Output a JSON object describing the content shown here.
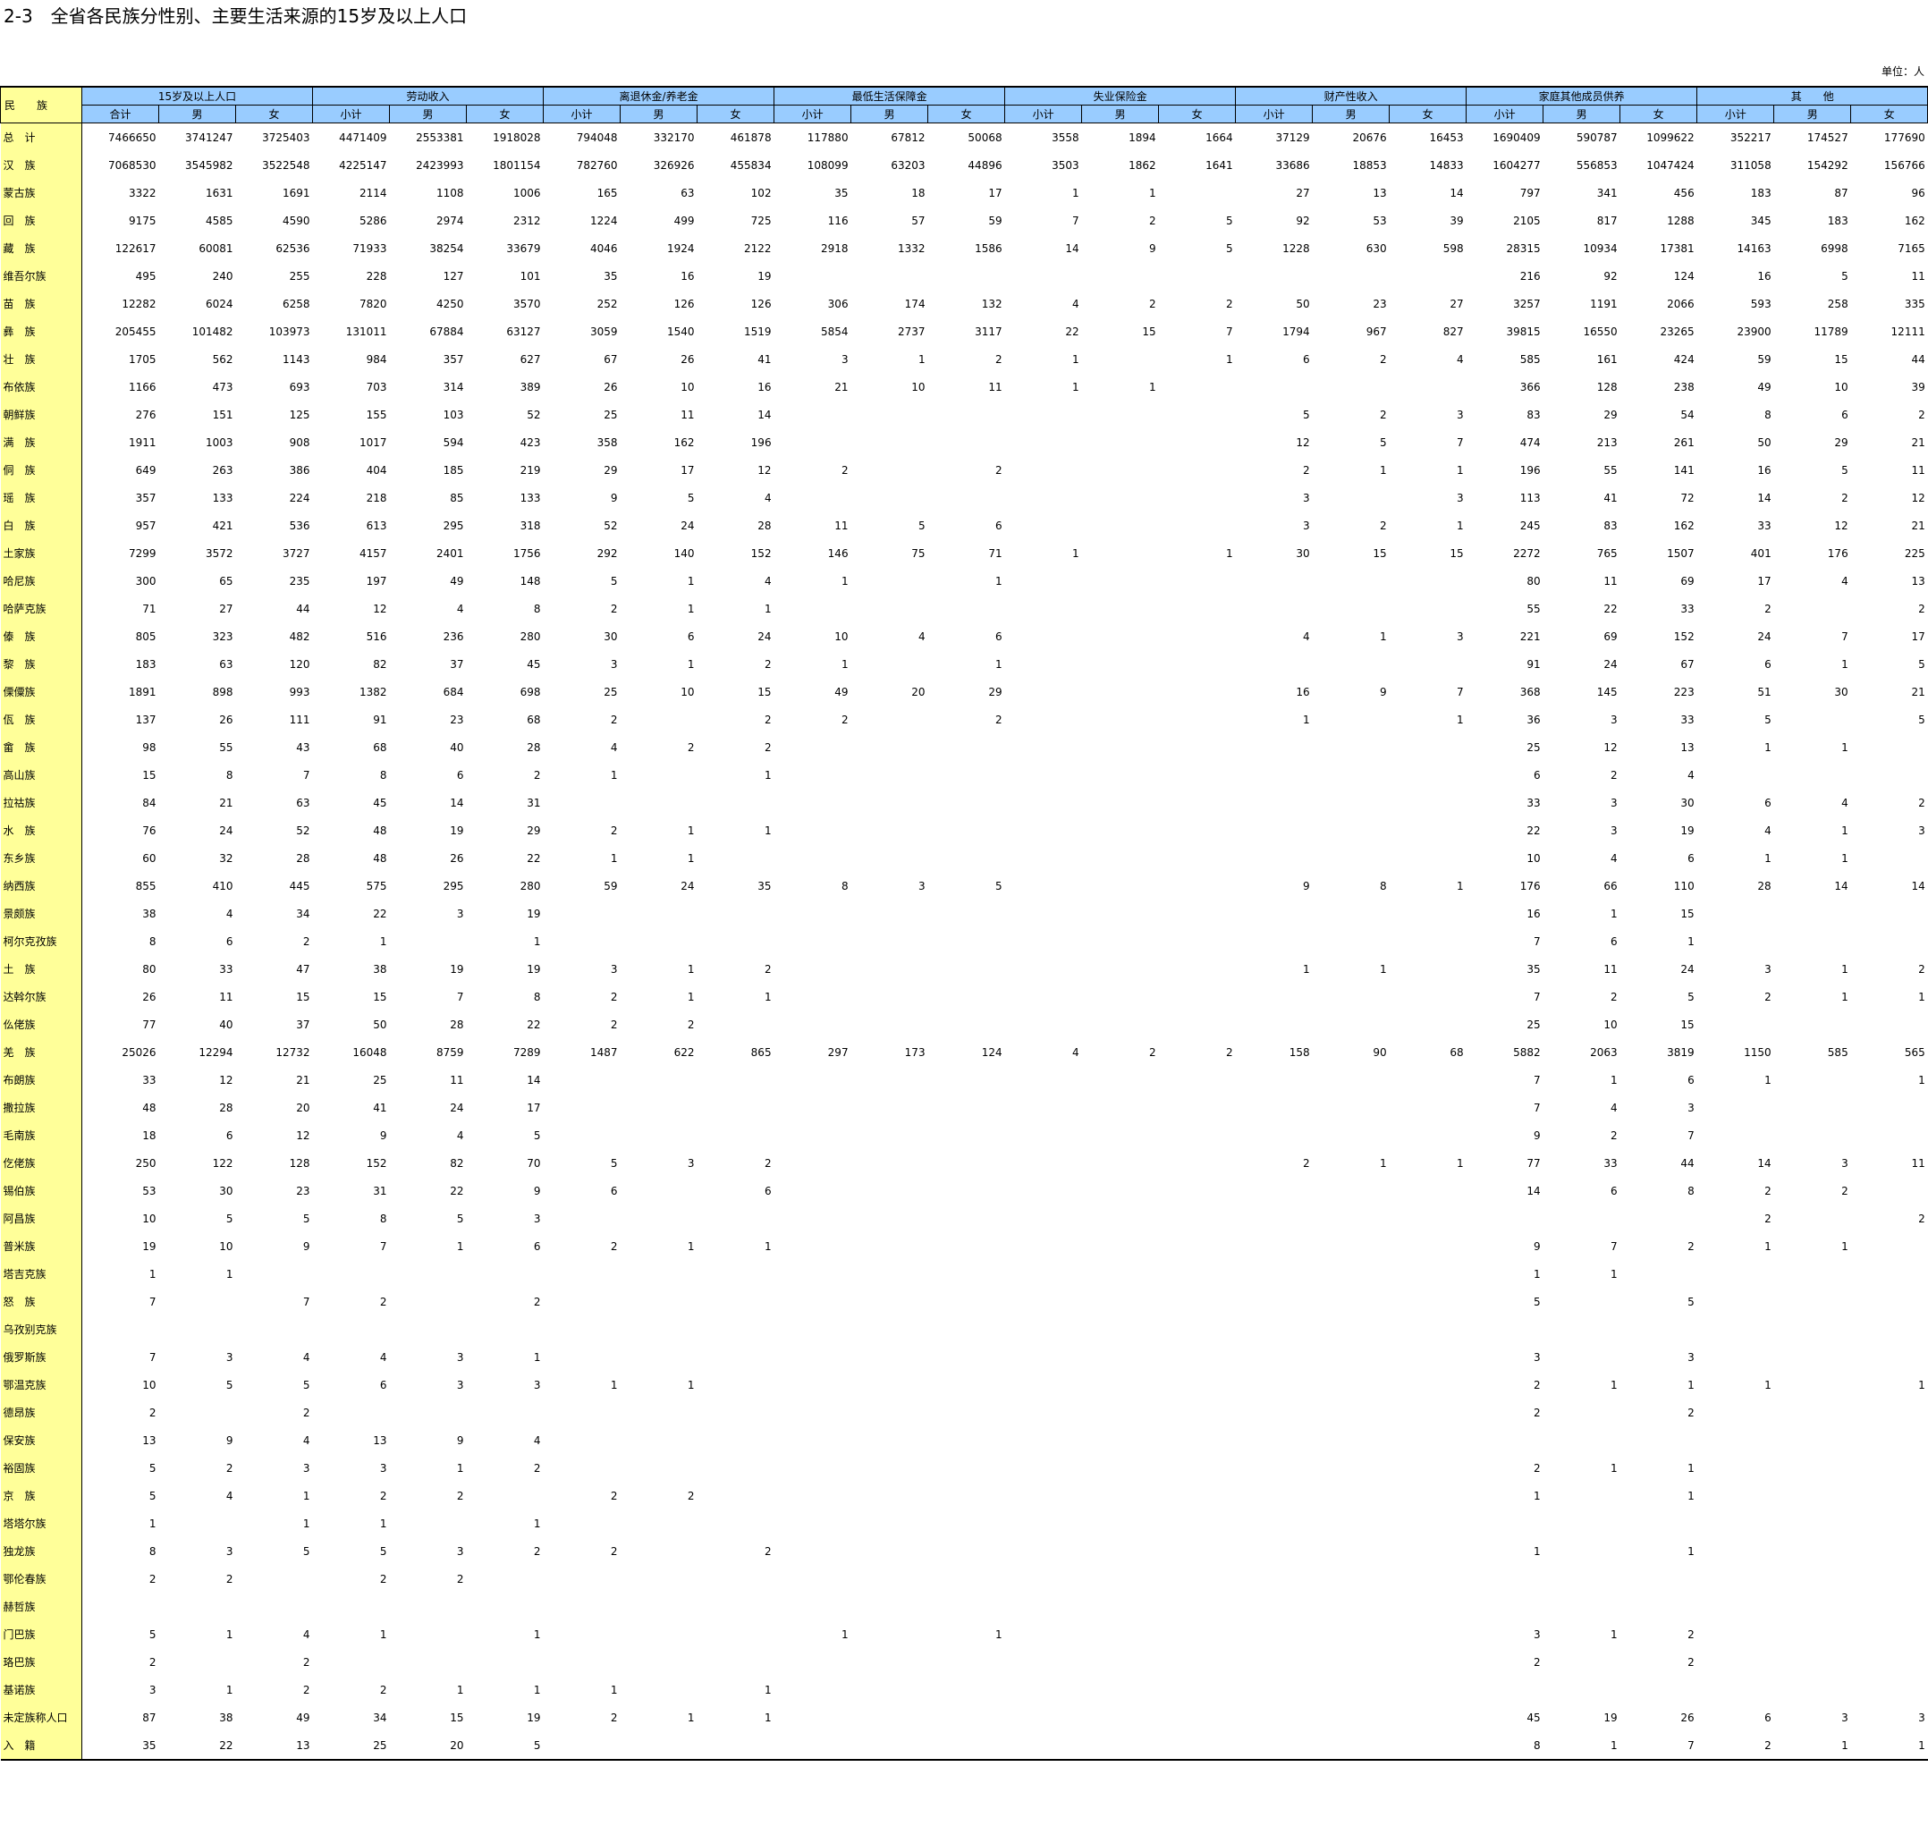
{
  "title": "2-3　全省各民族分性别、主要生活来源的15岁及以上人口",
  "unit": "单位：人",
  "header": {
    "ethnicity": "民　　族",
    "groups": [
      "15岁及以上人口",
      "劳动收入",
      "离退休金/养老金",
      "最低生活保障金",
      "失业保险金",
      "财产性收入",
      "家庭其他成员供养",
      "其　　他"
    ],
    "subs": [
      "合计",
      "男",
      "女",
      "小计",
      "男",
      "女",
      "小计",
      "男",
      "女",
      "小计",
      "男",
      "女",
      "小计",
      "男",
      "女",
      "小计",
      "男",
      "女",
      "小计",
      "男",
      "女",
      "小计",
      "男",
      "女"
    ]
  },
  "rows": [
    [
      "总　计",
      "7466650",
      "3741247",
      "3725403",
      "4471409",
      "2553381",
      "1918028",
      "794048",
      "332170",
      "461878",
      "117880",
      "67812",
      "50068",
      "3558",
      "1894",
      "1664",
      "37129",
      "20676",
      "16453",
      "1690409",
      "590787",
      "1099622",
      "352217",
      "174527",
      "177690"
    ],
    [
      "汉　族",
      "7068530",
      "3545982",
      "3522548",
      "4225147",
      "2423993",
      "1801154",
      "782760",
      "326926",
      "455834",
      "108099",
      "63203",
      "44896",
      "3503",
      "1862",
      "1641",
      "33686",
      "18853",
      "14833",
      "1604277",
      "556853",
      "1047424",
      "311058",
      "154292",
      "156766"
    ],
    [
      "蒙古族",
      "3322",
      "1631",
      "1691",
      "2114",
      "1108",
      "1006",
      "165",
      "63",
      "102",
      "35",
      "18",
      "17",
      "1",
      "1",
      "",
      "27",
      "13",
      "14",
      "797",
      "341",
      "456",
      "183",
      "87",
      "96"
    ],
    [
      "回　族",
      "9175",
      "4585",
      "4590",
      "5286",
      "2974",
      "2312",
      "1224",
      "499",
      "725",
      "116",
      "57",
      "59",
      "7",
      "2",
      "5",
      "92",
      "53",
      "39",
      "2105",
      "817",
      "1288",
      "345",
      "183",
      "162"
    ],
    [
      "藏　族",
      "122617",
      "60081",
      "62536",
      "71933",
      "38254",
      "33679",
      "4046",
      "1924",
      "2122",
      "2918",
      "1332",
      "1586",
      "14",
      "9",
      "5",
      "1228",
      "630",
      "598",
      "28315",
      "10934",
      "17381",
      "14163",
      "6998",
      "7165"
    ],
    [
      "维吾尔族",
      "495",
      "240",
      "255",
      "228",
      "127",
      "101",
      "35",
      "16",
      "19",
      "",
      "",
      "",
      "",
      "",
      "",
      "",
      "",
      "",
      "216",
      "92",
      "124",
      "16",
      "5",
      "11"
    ],
    [
      "苗　族",
      "12282",
      "6024",
      "6258",
      "7820",
      "4250",
      "3570",
      "252",
      "126",
      "126",
      "306",
      "174",
      "132",
      "4",
      "2",
      "2",
      "50",
      "23",
      "27",
      "3257",
      "1191",
      "2066",
      "593",
      "258",
      "335"
    ],
    [
      "彝　族",
      "205455",
      "101482",
      "103973",
      "131011",
      "67884",
      "63127",
      "3059",
      "1540",
      "1519",
      "5854",
      "2737",
      "3117",
      "22",
      "15",
      "7",
      "1794",
      "967",
      "827",
      "39815",
      "16550",
      "23265",
      "23900",
      "11789",
      "12111"
    ],
    [
      "壮　族",
      "1705",
      "562",
      "1143",
      "984",
      "357",
      "627",
      "67",
      "26",
      "41",
      "3",
      "1",
      "2",
      "1",
      "",
      "1",
      "6",
      "2",
      "4",
      "585",
      "161",
      "424",
      "59",
      "15",
      "44"
    ],
    [
      "布依族",
      "1166",
      "473",
      "693",
      "703",
      "314",
      "389",
      "26",
      "10",
      "16",
      "21",
      "10",
      "11",
      "1",
      "1",
      "",
      "",
      "",
      "",
      "366",
      "128",
      "238",
      "49",
      "10",
      "39"
    ],
    [
      "朝鲜族",
      "276",
      "151",
      "125",
      "155",
      "103",
      "52",
      "25",
      "11",
      "14",
      "",
      "",
      "",
      "",
      "",
      "",
      "5",
      "2",
      "3",
      "83",
      "29",
      "54",
      "8",
      "6",
      "2"
    ],
    [
      "满　族",
      "1911",
      "1003",
      "908",
      "1017",
      "594",
      "423",
      "358",
      "162",
      "196",
      "",
      "",
      "",
      "",
      "",
      "",
      "12",
      "5",
      "7",
      "474",
      "213",
      "261",
      "50",
      "29",
      "21"
    ],
    [
      "侗　族",
      "649",
      "263",
      "386",
      "404",
      "185",
      "219",
      "29",
      "17",
      "12",
      "2",
      "",
      "2",
      "",
      "",
      "",
      "2",
      "1",
      "1",
      "196",
      "55",
      "141",
      "16",
      "5",
      "11"
    ],
    [
      "瑶　族",
      "357",
      "133",
      "224",
      "218",
      "85",
      "133",
      "9",
      "5",
      "4",
      "",
      "",
      "",
      "",
      "",
      "",
      "3",
      "",
      "3",
      "113",
      "41",
      "72",
      "14",
      "2",
      "12"
    ],
    [
      "白　族",
      "957",
      "421",
      "536",
      "613",
      "295",
      "318",
      "52",
      "24",
      "28",
      "11",
      "5",
      "6",
      "",
      "",
      "",
      "3",
      "2",
      "1",
      "245",
      "83",
      "162",
      "33",
      "12",
      "21"
    ],
    [
      "土家族",
      "7299",
      "3572",
      "3727",
      "4157",
      "2401",
      "1756",
      "292",
      "140",
      "152",
      "146",
      "75",
      "71",
      "1",
      "",
      "1",
      "30",
      "15",
      "15",
      "2272",
      "765",
      "1507",
      "401",
      "176",
      "225"
    ],
    [
      "哈尼族",
      "300",
      "65",
      "235",
      "197",
      "49",
      "148",
      "5",
      "1",
      "4",
      "1",
      "",
      "1",
      "",
      "",
      "",
      "",
      "",
      "",
      "80",
      "11",
      "69",
      "17",
      "4",
      "13"
    ],
    [
      "哈萨克族",
      "71",
      "27",
      "44",
      "12",
      "4",
      "8",
      "2",
      "1",
      "1",
      "",
      "",
      "",
      "",
      "",
      "",
      "",
      "",
      "",
      "55",
      "22",
      "33",
      "2",
      "",
      "2"
    ],
    [
      "傣　族",
      "805",
      "323",
      "482",
      "516",
      "236",
      "280",
      "30",
      "6",
      "24",
      "10",
      "4",
      "6",
      "",
      "",
      "",
      "4",
      "1",
      "3",
      "221",
      "69",
      "152",
      "24",
      "7",
      "17"
    ],
    [
      "黎　族",
      "183",
      "63",
      "120",
      "82",
      "37",
      "45",
      "3",
      "1",
      "2",
      "1",
      "",
      "1",
      "",
      "",
      "",
      "",
      "",
      "",
      "91",
      "24",
      "67",
      "6",
      "1",
      "5"
    ],
    [
      "傈僳族",
      "1891",
      "898",
      "993",
      "1382",
      "684",
      "698",
      "25",
      "10",
      "15",
      "49",
      "20",
      "29",
      "",
      "",
      "",
      "16",
      "9",
      "7",
      "368",
      "145",
      "223",
      "51",
      "30",
      "21"
    ],
    [
      "佤　族",
      "137",
      "26",
      "111",
      "91",
      "23",
      "68",
      "2",
      "",
      "2",
      "2",
      "",
      "2",
      "",
      "",
      "",
      "1",
      "",
      "1",
      "36",
      "3",
      "33",
      "5",
      "",
      "5"
    ],
    [
      "畲　族",
      "98",
      "55",
      "43",
      "68",
      "40",
      "28",
      "4",
      "2",
      "2",
      "",
      "",
      "",
      "",
      "",
      "",
      "",
      "",
      "",
      "25",
      "12",
      "13",
      "1",
      "1",
      ""
    ],
    [
      "高山族",
      "15",
      "8",
      "7",
      "8",
      "6",
      "2",
      "1",
      "",
      "1",
      "",
      "",
      "",
      "",
      "",
      "",
      "",
      "",
      "",
      "6",
      "2",
      "4",
      "",
      "",
      ""
    ],
    [
      "拉祜族",
      "84",
      "21",
      "63",
      "45",
      "14",
      "31",
      "",
      "",
      "",
      "",
      "",
      "",
      "",
      "",
      "",
      "",
      "",
      "",
      "33",
      "3",
      "30",
      "6",
      "4",
      "2"
    ],
    [
      "水　族",
      "76",
      "24",
      "52",
      "48",
      "19",
      "29",
      "2",
      "1",
      "1",
      "",
      "",
      "",
      "",
      "",
      "",
      "",
      "",
      "",
      "22",
      "3",
      "19",
      "4",
      "1",
      "3"
    ],
    [
      "东乡族",
      "60",
      "32",
      "28",
      "48",
      "26",
      "22",
      "1",
      "1",
      "",
      "",
      "",
      "",
      "",
      "",
      "",
      "",
      "",
      "",
      "10",
      "4",
      "6",
      "1",
      "1",
      ""
    ],
    [
      "纳西族",
      "855",
      "410",
      "445",
      "575",
      "295",
      "280",
      "59",
      "24",
      "35",
      "8",
      "3",
      "5",
      "",
      "",
      "",
      "9",
      "8",
      "1",
      "176",
      "66",
      "110",
      "28",
      "14",
      "14"
    ],
    [
      "景颇族",
      "38",
      "4",
      "34",
      "22",
      "3",
      "19",
      "",
      "",
      "",
      "",
      "",
      "",
      "",
      "",
      "",
      "",
      "",
      "",
      "16",
      "1",
      "15",
      "",
      "",
      ""
    ],
    [
      "柯尔克孜族",
      "8",
      "6",
      "2",
      "1",
      "",
      "1",
      "",
      "",
      "",
      "",
      "",
      "",
      "",
      "",
      "",
      "",
      "",
      "",
      "7",
      "6",
      "1",
      "",
      "",
      ""
    ],
    [
      "土　族",
      "80",
      "33",
      "47",
      "38",
      "19",
      "19",
      "3",
      "1",
      "2",
      "",
      "",
      "",
      "",
      "",
      "",
      "1",
      "1",
      "",
      "35",
      "11",
      "24",
      "3",
      "1",
      "2"
    ],
    [
      "达斡尔族",
      "26",
      "11",
      "15",
      "15",
      "7",
      "8",
      "2",
      "1",
      "1",
      "",
      "",
      "",
      "",
      "",
      "",
      "",
      "",
      "",
      "7",
      "2",
      "5",
      "2",
      "1",
      "1"
    ],
    [
      "仫佬族",
      "77",
      "40",
      "37",
      "50",
      "28",
      "22",
      "2",
      "2",
      "",
      "",
      "",
      "",
      "",
      "",
      "",
      "",
      "",
      "",
      "25",
      "10",
      "15",
      "",
      "",
      ""
    ],
    [
      "羌　族",
      "25026",
      "12294",
      "12732",
      "16048",
      "8759",
      "7289",
      "1487",
      "622",
      "865",
      "297",
      "173",
      "124",
      "4",
      "2",
      "2",
      "158",
      "90",
      "68",
      "5882",
      "2063",
      "3819",
      "1150",
      "585",
      "565"
    ],
    [
      "布朗族",
      "33",
      "12",
      "21",
      "25",
      "11",
      "14",
      "",
      "",
      "",
      "",
      "",
      "",
      "",
      "",
      "",
      "",
      "",
      "",
      "7",
      "1",
      "6",
      "1",
      "",
      "1"
    ],
    [
      "撒拉族",
      "48",
      "28",
      "20",
      "41",
      "24",
      "17",
      "",
      "",
      "",
      "",
      "",
      "",
      "",
      "",
      "",
      "",
      "",
      "",
      "7",
      "4",
      "3",
      "",
      "",
      ""
    ],
    [
      "毛南族",
      "18",
      "6",
      "12",
      "9",
      "4",
      "5",
      "",
      "",
      "",
      "",
      "",
      "",
      "",
      "",
      "",
      "",
      "",
      "",
      "9",
      "2",
      "7",
      "",
      "",
      ""
    ],
    [
      "仡佬族",
      "250",
      "122",
      "128",
      "152",
      "82",
      "70",
      "5",
      "3",
      "2",
      "",
      "",
      "",
      "",
      "",
      "",
      "2",
      "1",
      "1",
      "77",
      "33",
      "44",
      "14",
      "3",
      "11"
    ],
    [
      "锡伯族",
      "53",
      "30",
      "23",
      "31",
      "22",
      "9",
      "6",
      "",
      "6",
      "",
      "",
      "",
      "",
      "",
      "",
      "",
      "",
      "",
      "14",
      "6",
      "8",
      "2",
      "2",
      ""
    ],
    [
      "阿昌族",
      "10",
      "5",
      "5",
      "8",
      "5",
      "3",
      "",
      "",
      "",
      "",
      "",
      "",
      "",
      "",
      "",
      "",
      "",
      "",
      "",
      "",
      "",
      "2",
      "",
      "2"
    ],
    [
      "普米族",
      "19",
      "10",
      "9",
      "7",
      "1",
      "6",
      "2",
      "1",
      "1",
      "",
      "",
      "",
      "",
      "",
      "",
      "",
      "",
      "",
      "9",
      "7",
      "2",
      "1",
      "1",
      ""
    ],
    [
      "塔吉克族",
      "1",
      "1",
      "",
      "",
      "",
      "",
      "",
      "",
      "",
      "",
      "",
      "",
      "",
      "",
      "",
      "",
      "",
      "",
      "1",
      "1",
      "",
      "",
      "",
      ""
    ],
    [
      "怒　族",
      "7",
      "",
      "7",
      "2",
      "",
      "2",
      "",
      "",
      "",
      "",
      "",
      "",
      "",
      "",
      "",
      "",
      "",
      "",
      "5",
      "",
      "5",
      "",
      "",
      ""
    ],
    [
      "乌孜别克族",
      "",
      "",
      "",
      "",
      "",
      "",
      "",
      "",
      "",
      "",
      "",
      "",
      "",
      "",
      "",
      "",
      "",
      "",
      "",
      "",
      "",
      "",
      "",
      ""
    ],
    [
      "俄罗斯族",
      "7",
      "3",
      "4",
      "4",
      "3",
      "1",
      "",
      "",
      "",
      "",
      "",
      "",
      "",
      "",
      "",
      "",
      "",
      "",
      "3",
      "",
      "3",
      "",
      "",
      ""
    ],
    [
      "鄂温克族",
      "10",
      "5",
      "5",
      "6",
      "3",
      "3",
      "1",
      "1",
      "",
      "",
      "",
      "",
      "",
      "",
      "",
      "",
      "",
      "",
      "2",
      "1",
      "1",
      "1",
      "",
      "1"
    ],
    [
      "德昂族",
      "2",
      "",
      "2",
      "",
      "",
      "",
      "",
      "",
      "",
      "",
      "",
      "",
      "",
      "",
      "",
      "",
      "",
      "",
      "2",
      "",
      "2",
      "",
      "",
      ""
    ],
    [
      "保安族",
      "13",
      "9",
      "4",
      "13",
      "9",
      "4",
      "",
      "",
      "",
      "",
      "",
      "",
      "",
      "",
      "",
      "",
      "",
      "",
      "",
      "",
      "",
      "",
      "",
      ""
    ],
    [
      "裕固族",
      "5",
      "2",
      "3",
      "3",
      "1",
      "2",
      "",
      "",
      "",
      "",
      "",
      "",
      "",
      "",
      "",
      "",
      "",
      "",
      "2",
      "1",
      "1",
      "",
      "",
      ""
    ],
    [
      "京　族",
      "5",
      "4",
      "1",
      "2",
      "2",
      "",
      "2",
      "2",
      "",
      "",
      "",
      "",
      "",
      "",
      "",
      "",
      "",
      "",
      "1",
      "",
      "1",
      "",
      "",
      ""
    ],
    [
      "塔塔尔族",
      "1",
      "",
      "1",
      "1",
      "",
      "1",
      "",
      "",
      "",
      "",
      "",
      "",
      "",
      "",
      "",
      "",
      "",
      "",
      "",
      "",
      "",
      "",
      "",
      ""
    ],
    [
      "独龙族",
      "8",
      "3",
      "5",
      "5",
      "3",
      "2",
      "2",
      "",
      "2",
      "",
      "",
      "",
      "",
      "",
      "",
      "",
      "",
      "",
      "1",
      "",
      "1",
      "",
      "",
      ""
    ],
    [
      "鄂伦春族",
      "2",
      "2",
      "",
      "2",
      "2",
      "",
      "",
      "",
      "",
      "",
      "",
      "",
      "",
      "",
      "",
      "",
      "",
      "",
      "",
      "",
      "",
      "",
      "",
      ""
    ],
    [
      "赫哲族",
      "",
      "",
      "",
      "",
      "",
      "",
      "",
      "",
      "",
      "",
      "",
      "",
      "",
      "",
      "",
      "",
      "",
      "",
      "",
      "",
      "",
      "",
      "",
      ""
    ],
    [
      "门巴族",
      "5",
      "1",
      "4",
      "1",
      "",
      "1",
      "",
      "",
      "",
      "1",
      "",
      "1",
      "",
      "",
      "",
      "",
      "",
      "",
      "3",
      "1",
      "2",
      "",
      "",
      ""
    ],
    [
      "珞巴族",
      "2",
      "",
      "2",
      "",
      "",
      "",
      "",
      "",
      "",
      "",
      "",
      "",
      "",
      "",
      "",
      "",
      "",
      "",
      "2",
      "",
      "2",
      "",
      "",
      ""
    ],
    [
      "基诺族",
      "3",
      "1",
      "2",
      "2",
      "1",
      "1",
      "1",
      "",
      "1",
      "",
      "",
      "",
      "",
      "",
      "",
      "",
      "",
      "",
      "",
      "",
      "",
      "",
      "",
      ""
    ],
    [
      "未定族称人口",
      "87",
      "38",
      "49",
      "34",
      "15",
      "19",
      "2",
      "1",
      "1",
      "",
      "",
      "",
      "",
      "",
      "",
      "",
      "",
      "",
      "45",
      "19",
      "26",
      "6",
      "3",
      "3"
    ],
    [
      "入　籍",
      "35",
      "22",
      "13",
      "25",
      "20",
      "5",
      "",
      "",
      "",
      "",
      "",
      "",
      "",
      "",
      "",
      "",
      "",
      "",
      "8",
      "1",
      "7",
      "2",
      "1",
      "1"
    ]
  ]
}
